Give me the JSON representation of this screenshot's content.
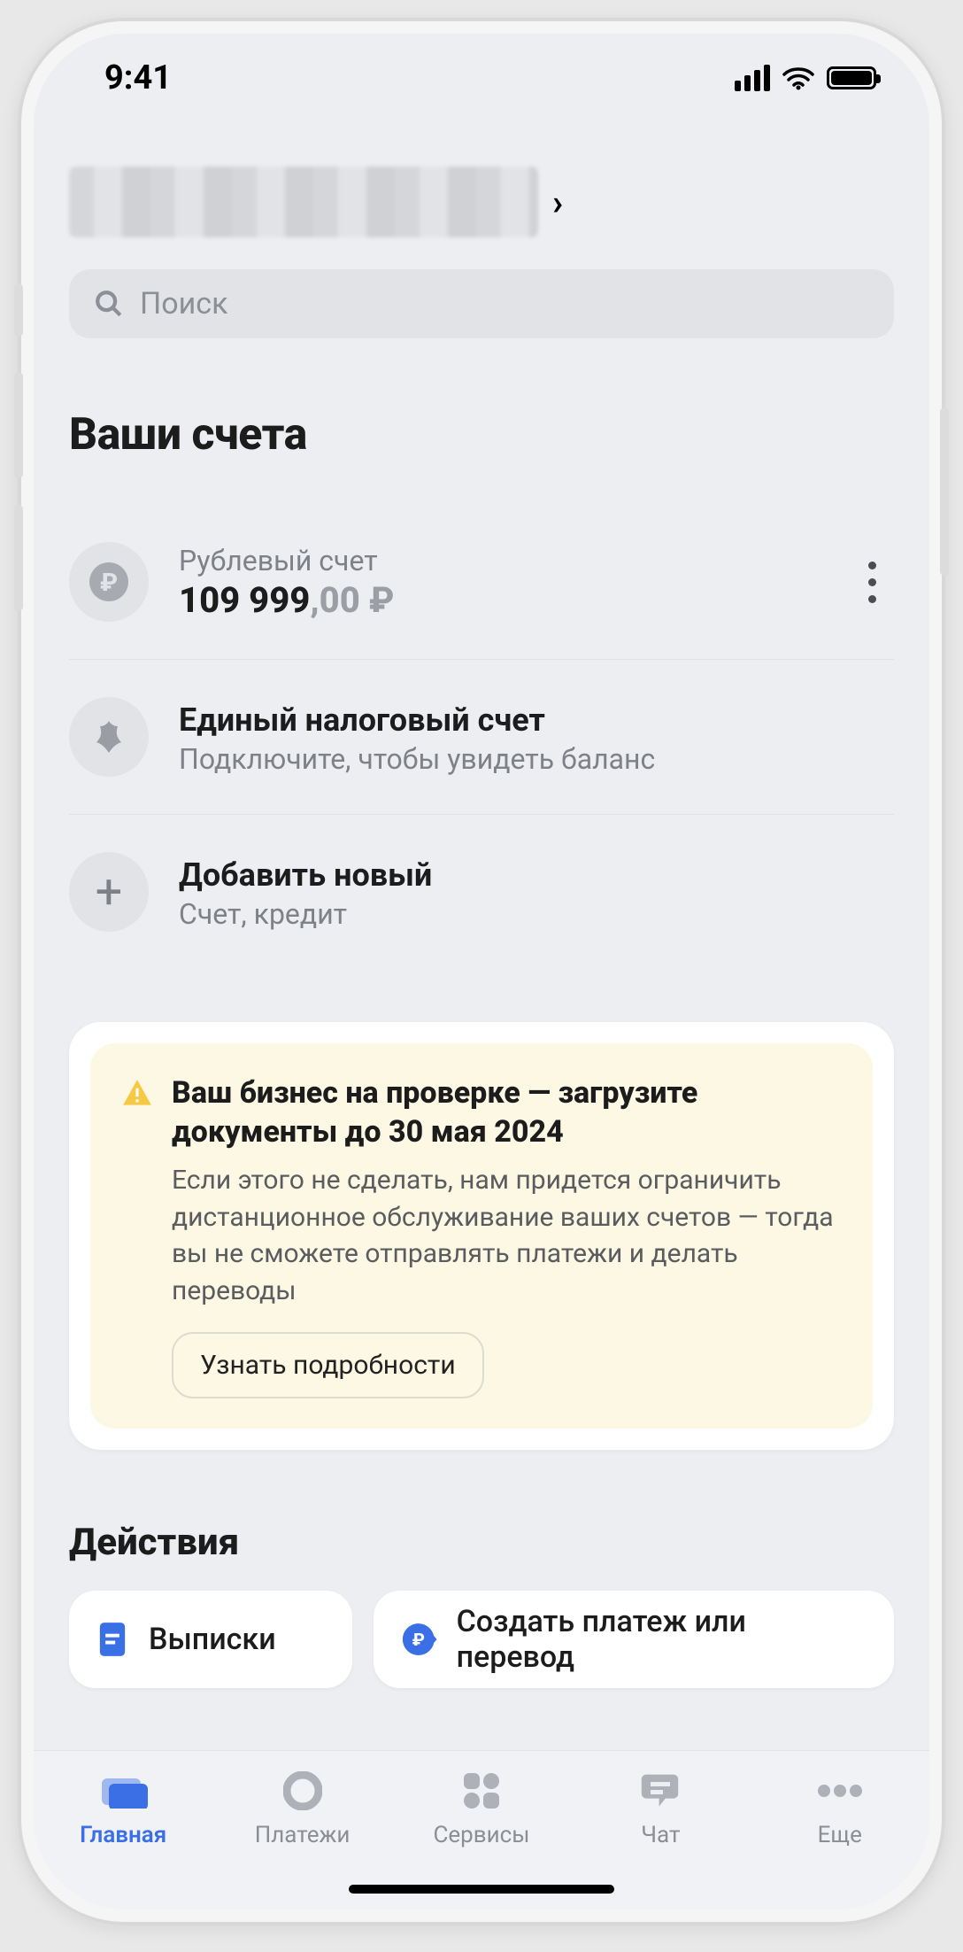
{
  "statusbar": {
    "time": "9:41"
  },
  "search": {
    "placeholder": "Поиск"
  },
  "accounts": {
    "heading": "Ваши счета",
    "rub": {
      "label": "Рублевый счет",
      "balance_main": "109 999",
      "balance_cents": ",00 ₽"
    },
    "tax": {
      "title": "Единый налоговый счет",
      "subtitle": "Подключите, чтобы увидеть баланс"
    },
    "add": {
      "title": "Добавить новый",
      "subtitle": "Счет, кредит"
    }
  },
  "alert": {
    "title": "Ваш бизнес на проверке — загрузите документы до 30 мая 2024",
    "body": "Если этого не сделать, нам придется ограничить дистанционное обслуживание ваших счетов — тогда вы не сможете отправлять платежи и делать переводы",
    "button": "Узнать подробности"
  },
  "actions": {
    "heading": "Действия",
    "statements": "Выписки",
    "create_payment": "Создать платеж или перевод"
  },
  "nav": {
    "home": "Главная",
    "payments": "Платежи",
    "services": "Сервисы",
    "chat": "Чат",
    "more": "Еще"
  }
}
